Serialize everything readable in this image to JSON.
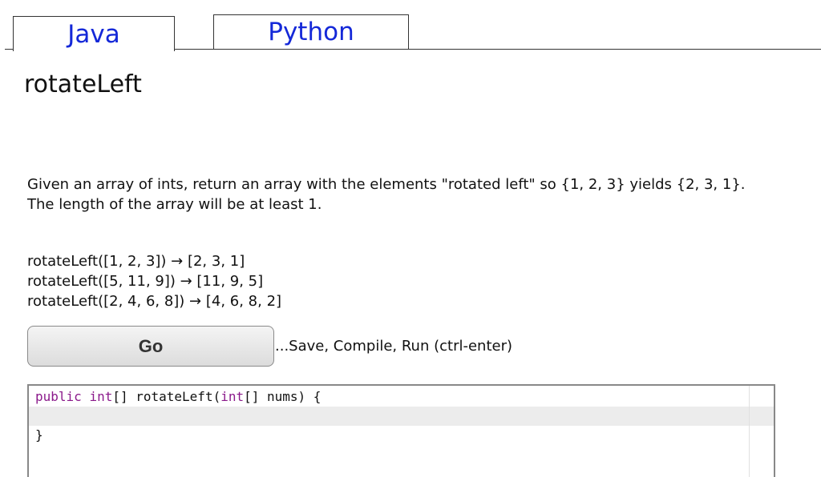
{
  "tabs": [
    {
      "label": "Java",
      "active": true
    },
    {
      "label": "Python",
      "active": false
    }
  ],
  "problem": {
    "title": "rotateLeft",
    "description": "Given an array of ints, return an array with the elements \"rotated left\" so {1, 2, 3} yields {2, 3, 1}. The length of the array will be at least 1.",
    "examples": [
      "rotateLeft([1, 2, 3]) → [2, 3, 1]",
      "rotateLeft([5, 11, 9]) → [11, 9, 5]",
      "rotateLeft([2, 4, 6, 8]) → [4, 6, 8, 2]"
    ]
  },
  "run": {
    "go_label": "Go",
    "hint": "...Save, Compile, Run (ctrl-enter)"
  },
  "editor": {
    "signature_kw1": "public",
    "signature_kw2": "int",
    "signature_mid": "[] rotateLeft(",
    "signature_kw3": "int",
    "signature_end": "[] nums) {",
    "line2": "",
    "line3": "}"
  },
  "colors": {
    "tab_text": "#1428d8",
    "keyword": "#8b1a8b",
    "current_line": "#ececec"
  }
}
